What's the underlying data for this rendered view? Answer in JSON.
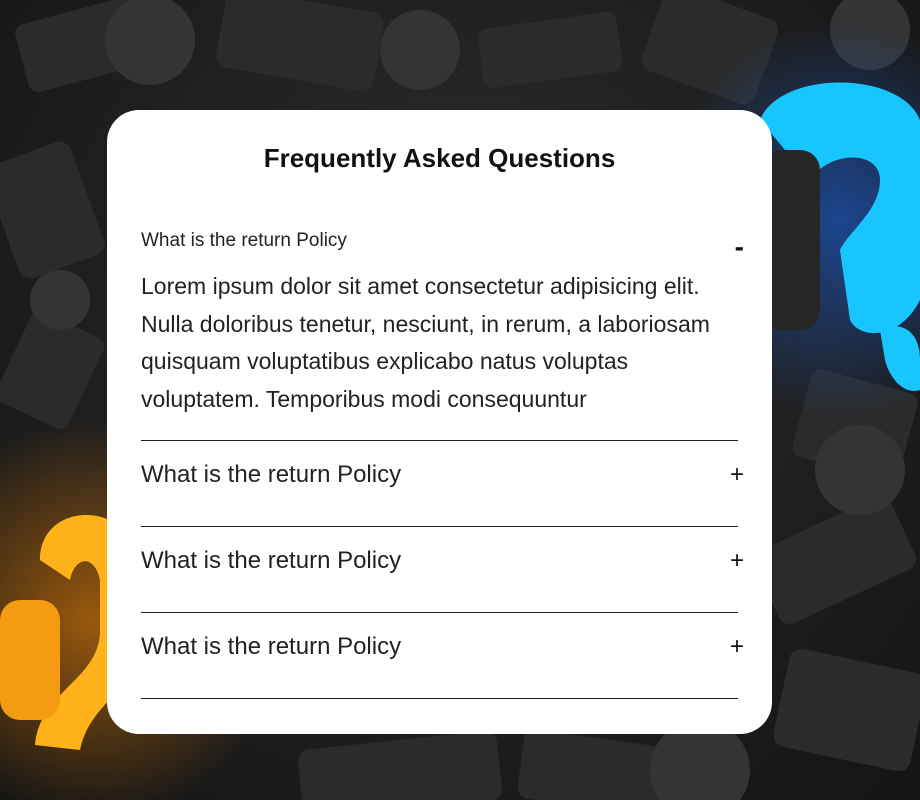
{
  "page": {
    "title": "Frequently Asked Questions"
  },
  "faq": {
    "items": [
      {
        "question": "What is the return Policy",
        "answer": "Lorem ipsum dolor sit amet consectetur adipisicing elit. Nulla doloribus tenetur, nesciunt, in rerum, a laboriosam quisquam voluptatibus explicabo natus voluptas voluptatem. Temporibus modi consequuntur",
        "toggle": "-",
        "expanded": true
      },
      {
        "question": "What is the return Policy",
        "toggle": "+",
        "expanded": false
      },
      {
        "question": "What is the return Policy",
        "toggle": "+",
        "expanded": false
      },
      {
        "question": "What is the return Policy",
        "toggle": "+",
        "expanded": false
      }
    ]
  },
  "colors": {
    "card": "#ffffff",
    "text": "#222222",
    "divider": "#222222",
    "bg_dark": "#1f1f1f",
    "accent_blue": "#18c5ff",
    "accent_orange": "#ffb21a"
  }
}
